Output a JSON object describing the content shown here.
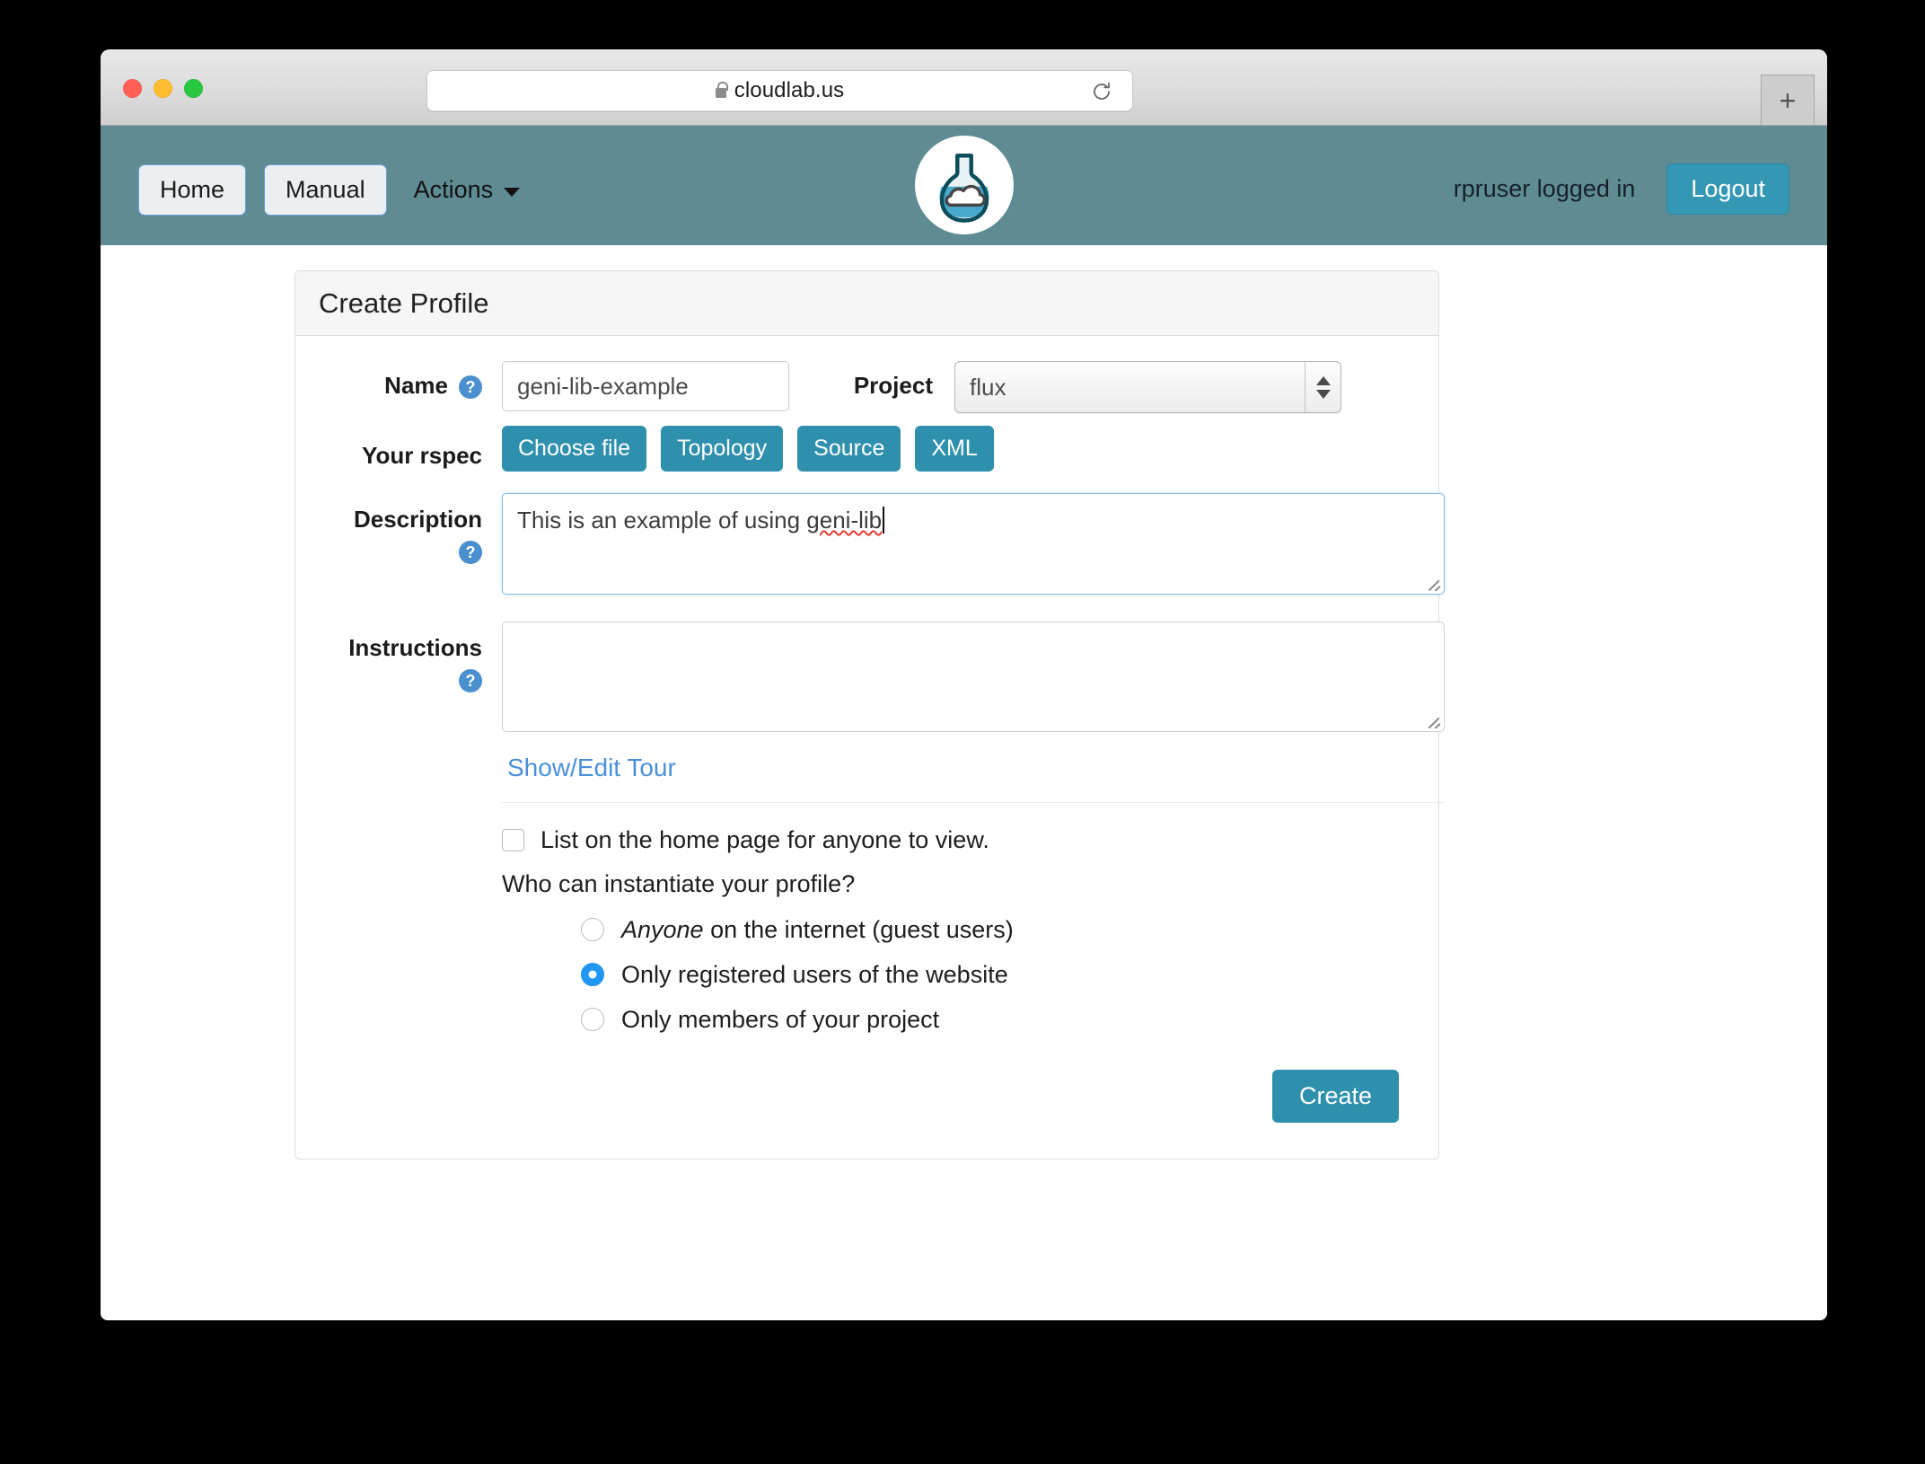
{
  "browser": {
    "url": "cloudlab.us",
    "lock_icon": "lock-icon",
    "reload_icon": "reload-icon",
    "new_tab_label": "+",
    "traffic_lights": [
      "close-button",
      "minimize-button",
      "zoom-button"
    ]
  },
  "navbar": {
    "home_label": "Home",
    "manual_label": "Manual",
    "actions_label": "Actions",
    "user_status": "rpruser logged in",
    "logout_label": "Logout",
    "logo_icon": "flask-cloud-logo",
    "background_color": "#5f8c93",
    "logout_color": "#3498b5"
  },
  "panel": {
    "title": "Create Profile"
  },
  "form": {
    "name_label": "Name",
    "name_value": "geni-lib-example",
    "project_label": "Project",
    "project_value": "flux",
    "rspec_label": "Your rspec",
    "rspec_buttons": [
      "Choose file",
      "Topology",
      "Source",
      "XML"
    ],
    "description_label": "Description",
    "description_value_prefix": "This is an example of using ",
    "description_value_misspelled": "geni-lib",
    "instructions_label": "Instructions",
    "instructions_value": "",
    "tour_link_label": "Show/Edit Tour",
    "help_icon": "question-mark-icon"
  },
  "visibility": {
    "list_home_checkbox_label": "List on the home page for anyone to view.",
    "list_home_checked": false,
    "question": "Who can instantiate your profile?",
    "options": [
      {
        "label_italic": "Anyone",
        "label_rest": " on the internet (guest users)",
        "selected": false
      },
      {
        "label_italic": "",
        "label_rest": "Only registered users of the website",
        "selected": true
      },
      {
        "label_italic": "",
        "label_rest": "Only members of your project",
        "selected": false
      }
    ]
  },
  "actions": {
    "create_label": "Create",
    "create_color": "#2f90ad"
  }
}
